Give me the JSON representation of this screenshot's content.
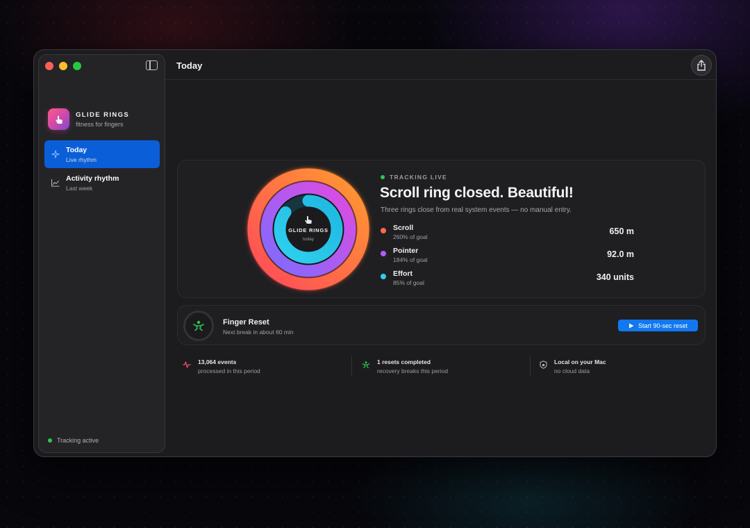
{
  "app": {
    "name": "GLIDE RINGS",
    "tagline": "fitness for fingers"
  },
  "sidebar": {
    "items": [
      {
        "label": "Today",
        "sub": "Live rhythm",
        "icon": "sparkle-icon",
        "active": true
      },
      {
        "label": "Activity rhythm",
        "sub": "Last week",
        "icon": "chart-line-icon",
        "active": false
      }
    ],
    "status": "Tracking active"
  },
  "header": {
    "title": "Today"
  },
  "rings": {
    "center_title": "GLIDE RINGS",
    "center_sub": "today",
    "live_label": "TRACKING LIVE",
    "headline": "Scroll ring closed. Beautiful!",
    "subline": "Three rings close from real system events — no manual entry.",
    "metrics": [
      {
        "name": "Scroll",
        "pct_text": "260% of goal",
        "value": "650 m",
        "color": "#ff6b4a",
        "progress": 2.6
      },
      {
        "name": "Pointer",
        "pct_text": "184% of goal",
        "value": "92.0 m",
        "color": "#b25cf5",
        "progress": 1.84
      },
      {
        "name": "Effort",
        "pct_text": "85% of goal",
        "value": "340 units",
        "color": "#2fd0ee",
        "progress": 0.85
      }
    ]
  },
  "reset": {
    "title": "Finger Reset",
    "sub": "Next break in about 60 min",
    "button": "Start 90-sec reset"
  },
  "stats": [
    {
      "line1": "13,064 events",
      "line2": "processed in this period",
      "icon": "pulse-icon",
      "color": "#ff4d6a"
    },
    {
      "line1": "1 resets completed",
      "line2": "recovery breaks this period",
      "icon": "stretch-figure-icon",
      "color": "#31c552"
    },
    {
      "line1": "Local on your Mac",
      "line2": "no cloud data",
      "icon": "shield-icon",
      "color": "#b0b0b6"
    }
  ],
  "colors": {
    "accent": "#0a5fd8",
    "button": "#1278f0",
    "live": "#31c552"
  }
}
